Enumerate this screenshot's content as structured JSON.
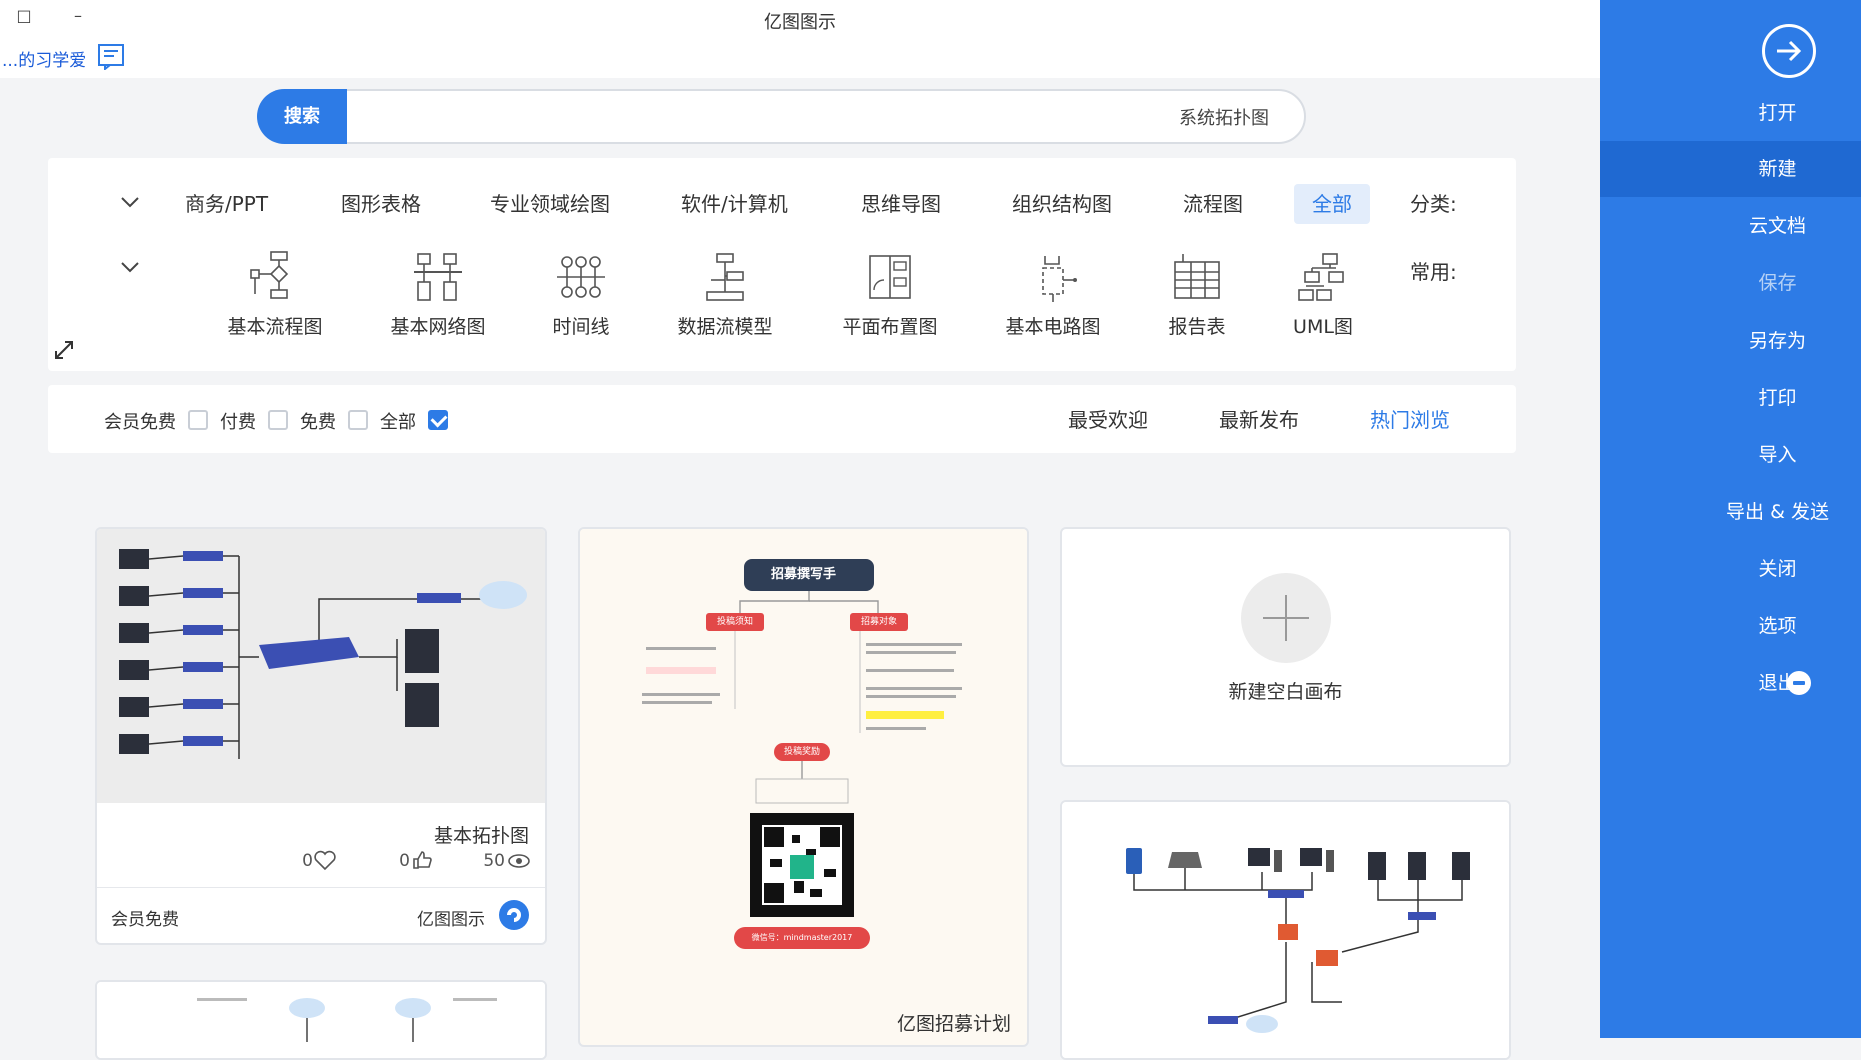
{
  "window": {
    "title": "亿图图示",
    "minimize": "–",
    "restore": "□"
  },
  "help": {
    "link_text": "...的习学爱",
    "icon": "help-book-icon"
  },
  "sidebar": {
    "open_icon": "arrow-right-circle-icon",
    "items": [
      {
        "label": "打开",
        "state": "normal"
      },
      {
        "label": "新建",
        "state": "active"
      },
      {
        "label": "云文档",
        "state": "normal"
      },
      {
        "label": "保存",
        "state": "disabled"
      },
      {
        "label": "另存为",
        "state": "normal"
      },
      {
        "label": "打印",
        "state": "normal"
      },
      {
        "label": "导入",
        "state": "normal"
      },
      {
        "label": "导出 & 发送",
        "state": "normal"
      },
      {
        "label": "关闭",
        "state": "normal"
      },
      {
        "label": "选项",
        "state": "normal"
      },
      {
        "label": "退出",
        "state": "normal"
      }
    ],
    "accent": "#2d7be6"
  },
  "search": {
    "button": "搜索",
    "value": "系统拓扑图"
  },
  "categories": {
    "label": "分类:",
    "items": [
      "全部",
      "流程图",
      "组织结构图",
      "思维导图",
      "软件/计算机",
      "专业领域绘图",
      "图形表格",
      "商务/PPT"
    ],
    "active": "全部"
  },
  "common": {
    "label": "常用:",
    "templates": [
      "UML图",
      "报告表",
      "基本电路图",
      "平面布置图",
      "数据流模型",
      "时间线",
      "基本网络图",
      "基本流程图"
    ]
  },
  "sort": {
    "tabs": [
      "热门浏览",
      "最新发布",
      "最受欢迎"
    ],
    "active": "热门浏览"
  },
  "filters": [
    {
      "label": "全部",
      "checked": true
    },
    {
      "label": "免费",
      "checked": false
    },
    {
      "label": "付费",
      "checked": false
    },
    {
      "label": "会员免费",
      "checked": false
    }
  ],
  "cards": {
    "topology": {
      "title": "基本拓扑图",
      "views": "50",
      "likes": "0",
      "favorites": "0",
      "author": "亿图图示",
      "price": "会员免费"
    },
    "mindmap": {
      "title": "亿图招募计划",
      "center": "招募撰写手",
      "left_node": "投稿须知",
      "right_node": "招募对象",
      "bottom_node": "投稿奖励",
      "contact": "微信号：mindmaster2017"
    },
    "blank": {
      "label": "新建空白画布"
    }
  }
}
